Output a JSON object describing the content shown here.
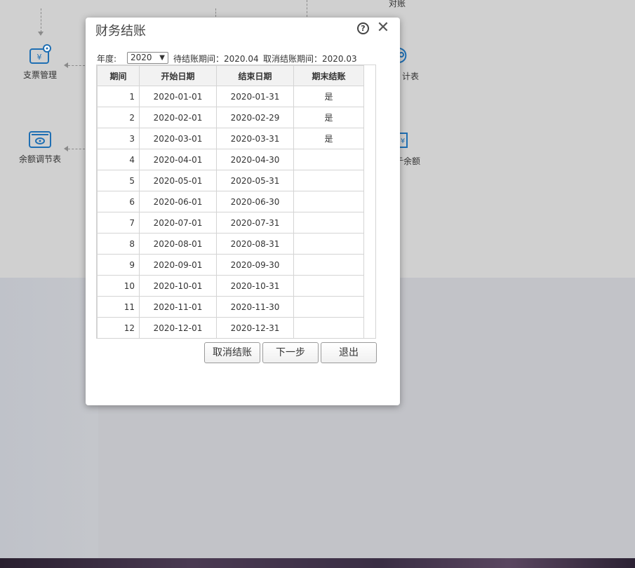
{
  "background": {
    "top_label": "对账",
    "modules": [
      {
        "label": "支票管理",
        "icon": "cheque-icon"
      },
      {
        "label": "余额调节表",
        "icon": "balance-adjust-icon"
      },
      {
        "label": "统计表",
        "visible_text": "计表",
        "icon": "statistics-icon"
      },
      {
        "label": "银行余额",
        "visible_text": "亍余额",
        "icon": "bank-balance-icon"
      }
    ],
    "accent_color": "#1f6fb3"
  },
  "dialog": {
    "title": "财务结账",
    "help_icon": "help-icon",
    "close_icon": "close-icon",
    "year_label": "年度:",
    "year_value": "2020",
    "pending_period_text": "待结账期间：2020.04",
    "cancel_period_text": "取消结账期间：2020.03",
    "table": {
      "columns": [
        "期间",
        "开始日期",
        "结束日期",
        "期末结账"
      ],
      "rows": [
        {
          "period": "1",
          "start": "2020-01-01",
          "end": "2020-01-31",
          "closed": "是"
        },
        {
          "period": "2",
          "start": "2020-02-01",
          "end": "2020-02-29",
          "closed": "是"
        },
        {
          "period": "3",
          "start": "2020-03-01",
          "end": "2020-03-31",
          "closed": "是"
        },
        {
          "period": "4",
          "start": "2020-04-01",
          "end": "2020-04-30",
          "closed": ""
        },
        {
          "period": "5",
          "start": "2020-05-01",
          "end": "2020-05-31",
          "closed": ""
        },
        {
          "period": "6",
          "start": "2020-06-01",
          "end": "2020-06-30",
          "closed": ""
        },
        {
          "period": "7",
          "start": "2020-07-01",
          "end": "2020-07-31",
          "closed": ""
        },
        {
          "period": "8",
          "start": "2020-08-01",
          "end": "2020-08-31",
          "closed": ""
        },
        {
          "period": "9",
          "start": "2020-09-01",
          "end": "2020-09-30",
          "closed": ""
        },
        {
          "period": "10",
          "start": "2020-10-01",
          "end": "2020-10-31",
          "closed": ""
        },
        {
          "period": "11",
          "start": "2020-11-01",
          "end": "2020-11-30",
          "closed": ""
        },
        {
          "period": "12",
          "start": "2020-12-01",
          "end": "2020-12-31",
          "closed": ""
        }
      ]
    },
    "buttons": {
      "cancel_close": "取消结账",
      "next_step": "下一步",
      "exit": "退出"
    }
  }
}
